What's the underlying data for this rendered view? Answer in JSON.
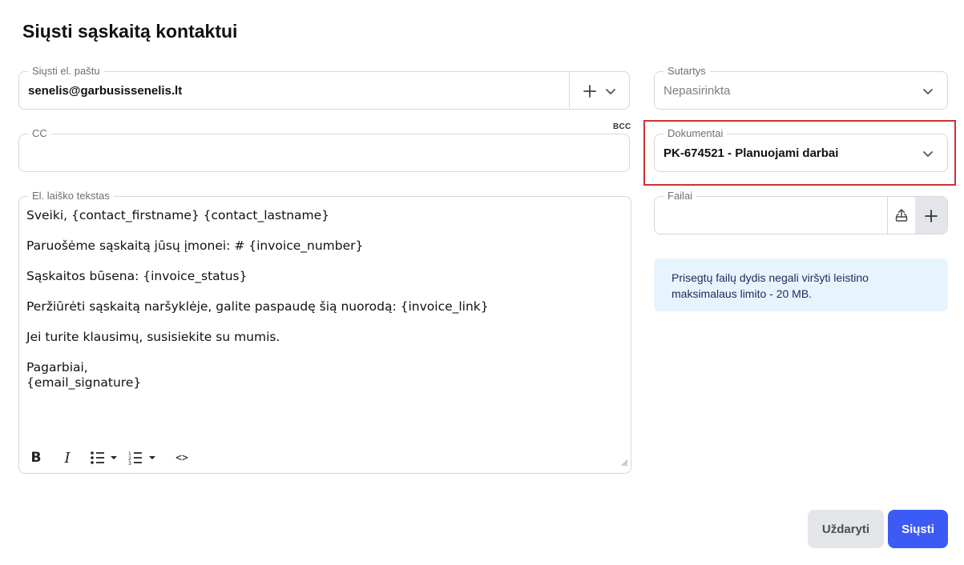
{
  "dialog": {
    "title": "Siųsti sąskaitą kontaktui"
  },
  "email_field": {
    "label": "Siųsti el. paštu",
    "value": "senelis@garbusissenelis.lt"
  },
  "cc_field": {
    "label": "CC",
    "value": "",
    "bcc_label": "BCC"
  },
  "body_field": {
    "label": "El. laiško tekstas",
    "lines": [
      "Sveiki, {contact_firstname} {contact_lastname}",
      "Paruošėme sąskaitą jūsų įmonei: # {invoice_number}",
      "Sąskaitos būsena: {invoice_status}",
      "Peržiūrėti sąskaitą naršyklėje, galite paspaudę šią nuorodą: {invoice_link}",
      "Jei turite klausimų, susisiekite su mumis.",
      "Pagarbiai,",
      "{email_signature}"
    ]
  },
  "toolbar": {
    "bold": "B",
    "italic": "I",
    "code": "<>"
  },
  "contracts_field": {
    "label": "Sutartys",
    "value": "Nepasirinkta"
  },
  "documents_field": {
    "label": "Dokumentai",
    "value": "PK-674521 - Planuojami darbai"
  },
  "files_field": {
    "label": "Failai",
    "value": ""
  },
  "info": {
    "text": "Prisegtų failų dydis negali viršyti leistino maksimalaus limito - 20 MB."
  },
  "buttons": {
    "close": "Uždaryti",
    "send": "Siųsti"
  },
  "colors": {
    "primary": "#3c5bf4",
    "highlight": "#d32f2f",
    "info_bg": "#e8f4fd"
  },
  "icons": [
    "plus-icon",
    "chevron-down-icon",
    "upload-icon",
    "bold-icon",
    "italic-icon",
    "bullet-list-icon",
    "numbered-list-icon",
    "code-icon",
    "resize-handle-icon"
  ]
}
